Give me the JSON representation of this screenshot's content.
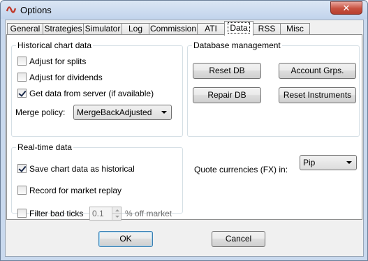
{
  "window": {
    "title": "Options",
    "close_glyph": "✕"
  },
  "tabs": [
    {
      "label": "General"
    },
    {
      "label": "Strategies"
    },
    {
      "label": "Simulator"
    },
    {
      "label": "Log"
    },
    {
      "label": "Commission"
    },
    {
      "label": "ATI"
    },
    {
      "label": "Data",
      "selected": true
    },
    {
      "label": "RSS"
    },
    {
      "label": "Misc"
    }
  ],
  "historical": {
    "title": "Historical chart data",
    "adjust_splits": {
      "label": "Adjust for splits",
      "checked": false
    },
    "adjust_dividends": {
      "label": "Adjust for dividends",
      "checked": false
    },
    "get_from_server": {
      "label": "Get data from server (if available)",
      "checked": true
    },
    "merge_label": "Merge policy:",
    "merge_value": "MergeBackAdjusted"
  },
  "database": {
    "title": "Database management",
    "reset_db": "Reset DB",
    "account_grps": "Account Grps.",
    "repair_db": "Repair DB",
    "reset_instruments": "Reset Instruments"
  },
  "realtime": {
    "title": "Real-time data",
    "save_historical": {
      "label": "Save chart data as historical",
      "checked": true
    },
    "record_replay": {
      "label": "Record for market replay",
      "checked": false
    },
    "filter_bad_ticks": {
      "label": "Filter bad ticks",
      "checked": false
    },
    "filter_value": "0.1",
    "filter_suffix": "% off market"
  },
  "quote": {
    "label": "Quote currencies (FX) in:",
    "value": "Pip"
  },
  "footer": {
    "ok": "OK",
    "cancel": "Cancel"
  }
}
